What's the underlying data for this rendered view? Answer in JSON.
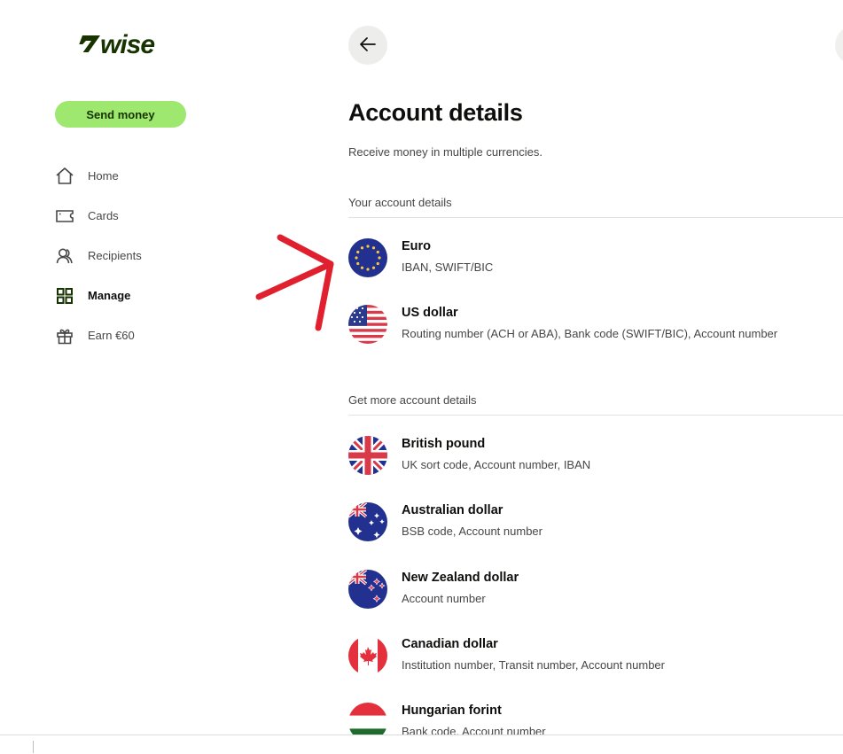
{
  "brand": {
    "logo_text": "wise",
    "logo_mark": "7",
    "color": "#163300",
    "accent": "#9fe870"
  },
  "sidebar": {
    "send_money_label": "Send money",
    "items": [
      {
        "label": "Home",
        "icon": "home-icon",
        "active": false
      },
      {
        "label": "Cards",
        "icon": "card-icon",
        "active": false
      },
      {
        "label": "Recipients",
        "icon": "recipients-icon",
        "active": false
      },
      {
        "label": "Manage",
        "icon": "grid-icon",
        "active": true
      },
      {
        "label": "Earn €60",
        "icon": "gift-icon",
        "active": false
      }
    ]
  },
  "header": {
    "back_icon": "arrow-left-icon"
  },
  "main": {
    "title": "Account details",
    "subtitle": "Receive money in multiple currencies.",
    "sections": [
      {
        "heading": "Your account details",
        "currencies": [
          {
            "name": "Euro",
            "details": "IBAN, SWIFT/BIC",
            "flag": "eu-flag-icon"
          },
          {
            "name": "US dollar",
            "details": "Routing number (ACH or ABA), Bank code (SWIFT/BIC), Account number",
            "flag": "us-flag-icon"
          }
        ]
      },
      {
        "heading": "Get more account details",
        "currencies": [
          {
            "name": "British pound",
            "details": "UK sort code, Account number, IBAN",
            "flag": "gb-flag-icon"
          },
          {
            "name": "Australian dollar",
            "details": "BSB code, Account number",
            "flag": "au-flag-icon"
          },
          {
            "name": "New Zealand dollar",
            "details": "Account number",
            "flag": "nz-flag-icon"
          },
          {
            "name": "Canadian dollar",
            "details": "Institution number, Transit number, Account number",
            "flag": "ca-flag-icon"
          },
          {
            "name": "Hungarian forint",
            "details": "Bank code, Account number",
            "flag": "hu-flag-icon"
          }
        ]
      }
    ]
  },
  "annotation": {
    "type": "red-arrow",
    "color": "#e0202e",
    "points_to": "Euro"
  }
}
